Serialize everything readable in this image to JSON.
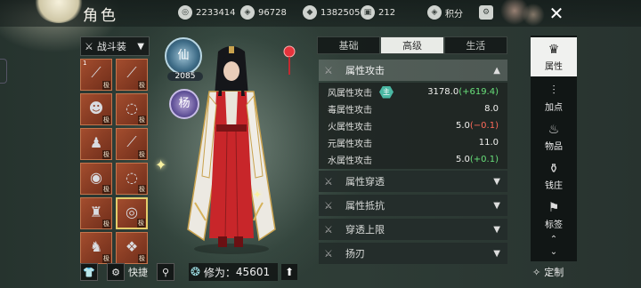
{
  "header": {
    "title": "角色",
    "resources": [
      {
        "icon": "coin-stack-icon",
        "glyph": "◎",
        "value": "2233414"
      },
      {
        "icon": "gem-purse-icon",
        "glyph": "◈",
        "value": "96728"
      },
      {
        "icon": "silver-ingot-icon",
        "glyph": "◆",
        "value": "1382505"
      },
      {
        "icon": "ticket-icon",
        "glyph": "▣",
        "value": "212"
      }
    ],
    "points_label": "积分",
    "close_glyph": "✕"
  },
  "left": {
    "gear_preset": "战斗装",
    "slots": [
      {
        "glyph": "⟋",
        "tag": "极",
        "num": "1",
        "selected": false
      },
      {
        "glyph": "⟋",
        "tag": "极",
        "num": "",
        "selected": false
      },
      {
        "glyph": "☻",
        "tag": "极",
        "num": "",
        "selected": false
      },
      {
        "glyph": "◌",
        "tag": "极",
        "num": "",
        "selected": false
      },
      {
        "glyph": "♟",
        "tag": "极",
        "num": "",
        "selected": false
      },
      {
        "glyph": "⟋",
        "tag": "极",
        "num": "",
        "selected": false
      },
      {
        "glyph": "◉",
        "tag": "极",
        "num": "",
        "selected": false
      },
      {
        "glyph": "◌",
        "tag": "极",
        "num": "",
        "selected": false
      },
      {
        "glyph": "♜",
        "tag": "极",
        "num": "",
        "selected": false
      },
      {
        "glyph": "◎",
        "tag": "极",
        "num": "",
        "selected": true
      },
      {
        "glyph": "♞",
        "tag": "极",
        "num": "",
        "selected": false
      },
      {
        "glyph": "❖",
        "tag": "极",
        "num": "",
        "selected": false
      }
    ],
    "shortcut_label": "快捷",
    "cultivation_label": "修为：",
    "cultivation_value": "45601"
  },
  "badges": {
    "top_char": "仙",
    "level": "2085",
    "bottom_char": "杨"
  },
  "tabs": [
    "基础",
    "高级",
    "生活"
  ],
  "active_tab": "高级",
  "sections": [
    {
      "label": "属性攻击",
      "open": true
    },
    {
      "label": "属性穿透",
      "open": false
    },
    {
      "label": "属性抵抗",
      "open": false
    },
    {
      "label": "穿透上限",
      "open": false
    },
    {
      "label": "扬刃",
      "open": false
    }
  ],
  "attributes": [
    {
      "name": "风属性攻击",
      "main": "主",
      "base": "3178.0",
      "delta": "(+619.4)",
      "delta_type": "pos"
    },
    {
      "name": "毒属性攻击",
      "main": "",
      "base": "8.0",
      "delta": "",
      "delta_type": ""
    },
    {
      "name": "火属性攻击",
      "main": "",
      "base": "5.0",
      "delta": "(−0.1)",
      "delta_type": "neg"
    },
    {
      "name": "元属性攻击",
      "main": "",
      "base": "11.0",
      "delta": "",
      "delta_type": ""
    },
    {
      "name": "水属性攻击",
      "main": "",
      "base": "5.0",
      "delta": "(+0.1)",
      "delta_type": "pos"
    }
  ],
  "sidenav": [
    {
      "label": "属性",
      "icon": "scholar-hat-icon",
      "glyph": "♛",
      "active": true
    },
    {
      "label": "加点",
      "icon": "sliders-icon",
      "glyph": "⫶",
      "active": false
    },
    {
      "label": "物品",
      "icon": "bag-icon",
      "glyph": "♨",
      "active": false
    },
    {
      "label": "钱庄",
      "icon": "money-bag-icon",
      "glyph": "⚱",
      "active": false
    },
    {
      "label": "标签",
      "icon": "tag-icon",
      "glyph": "⚑",
      "active": false
    }
  ],
  "custom_label": "定制"
}
